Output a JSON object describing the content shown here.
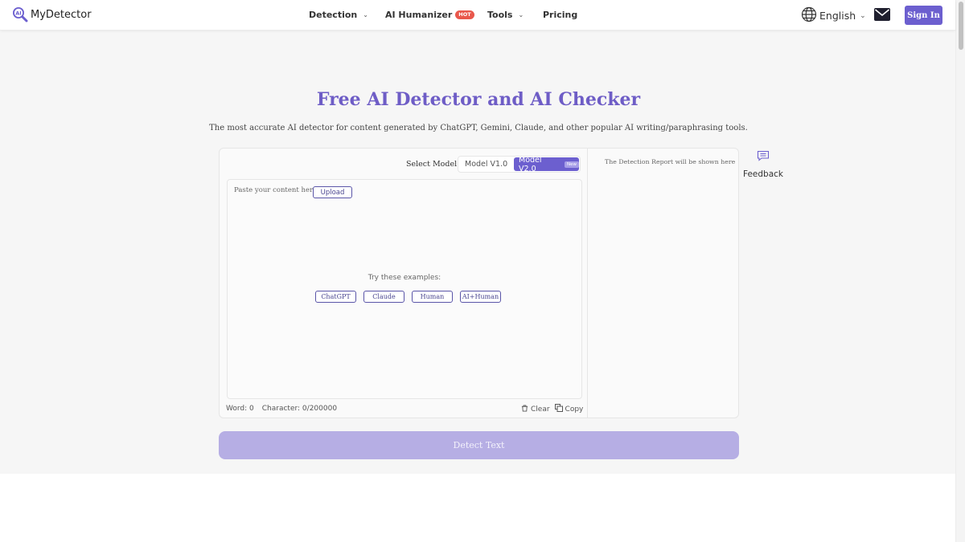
{
  "header": {
    "brand": "MyDetector",
    "nav": [
      {
        "label": "Detection",
        "has_dropdown": true
      },
      {
        "label": "AI Humanizer",
        "badge": "HOT"
      },
      {
        "label": "Tools",
        "has_dropdown": true
      },
      {
        "label": "Pricing"
      }
    ],
    "language": "English",
    "sign_in_label": "Sign In"
  },
  "hero": {
    "title": "Free AI Detector and AI Checker",
    "subtitle": "The most accurate AI detector for content generated by ChatGPT, Gemini, Claude, and other popular AI writing/paraphrasing tools."
  },
  "detector": {
    "select_model_label": "Select Model:",
    "models": [
      "Model V1.0",
      "Model V2.0"
    ],
    "selected_model": "Model V2.0",
    "new_badge": "New",
    "placeholder": "Paste your content here or",
    "upload_label": "Upload",
    "examples_title": "Try these examples:",
    "examples": [
      "ChatGPT",
      "Claude",
      "Human",
      "AI+Human"
    ],
    "word_count_label": "Word: 0",
    "char_count_label": "Character: 0/200000",
    "clear_label": "Clear",
    "copy_label": "Copy",
    "report_placeholder": "The Detection Report will be shown here",
    "detect_button": "Detect Text"
  },
  "feedback_label": "Feedback",
  "colors": {
    "brand": "#6c5fcf",
    "title": "#6e5dc6",
    "hot_badge": "#e9574b",
    "detect_disabled": "#b6aee4"
  }
}
